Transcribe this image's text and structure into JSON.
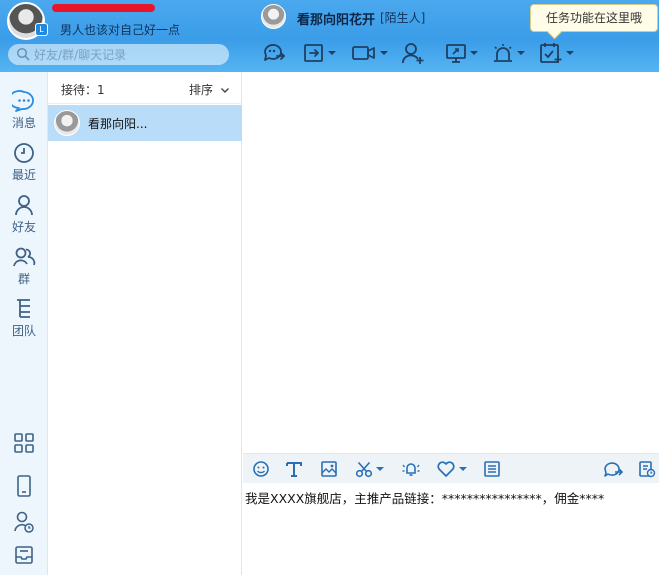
{
  "profile": {
    "signature": "男人也该对自己好一点"
  },
  "search": {
    "placeholder": "好友/群/聊天记录"
  },
  "chat": {
    "name": "看那向阳花开",
    "tag": "[陌生人]"
  },
  "tooltip": {
    "text": "任务功能在这里哦"
  },
  "header_toolbar": [
    {
      "icon": "chat-forward-icon",
      "has_dropdown": false
    },
    {
      "icon": "share-screen-icon",
      "has_dropdown": true
    },
    {
      "icon": "video-call-icon",
      "has_dropdown": true
    },
    {
      "icon": "add-friend-icon",
      "has_dropdown": false
    },
    {
      "icon": "remote-desktop-icon",
      "has_dropdown": true
    },
    {
      "icon": "alarm-icon",
      "has_dropdown": true
    },
    {
      "icon": "task-calendar-icon",
      "has_dropdown": true
    }
  ],
  "leftnav": {
    "items": [
      {
        "label": "消息",
        "icon": "message-icon"
      },
      {
        "label": "最近",
        "icon": "clock-icon"
      },
      {
        "label": "好友",
        "icon": "person-icon"
      },
      {
        "label": "群",
        "icon": "group-icon"
      },
      {
        "label": "团队",
        "icon": "team-tree-icon"
      }
    ],
    "bottom_icons": [
      "apps-grid-icon",
      "phone-icon",
      "user-clock-icon",
      "inbox-icon"
    ]
  },
  "contact_list": {
    "reception_label": "接待：1",
    "sort_label": "排序",
    "rows": [
      {
        "name": "看那向阳..."
      }
    ]
  },
  "input_toolbar": [
    "emoji-icon",
    "font-icon",
    "image-icon",
    "scissors-icon",
    "shake-bell-icon",
    "heart-icon",
    "card-icon",
    "quick-reply-icon",
    "history-icon"
  ],
  "input": {
    "message": "我是XXXX旗舰店，主推产品链接：****************，佣金****"
  },
  "colors": {
    "header_blue": "#3b9de8",
    "selected_row": "#b9dcf8",
    "icon_dark": "#1f3f63",
    "icon_blue": "#2a6fb5",
    "redaction_red": "#e8142a"
  }
}
